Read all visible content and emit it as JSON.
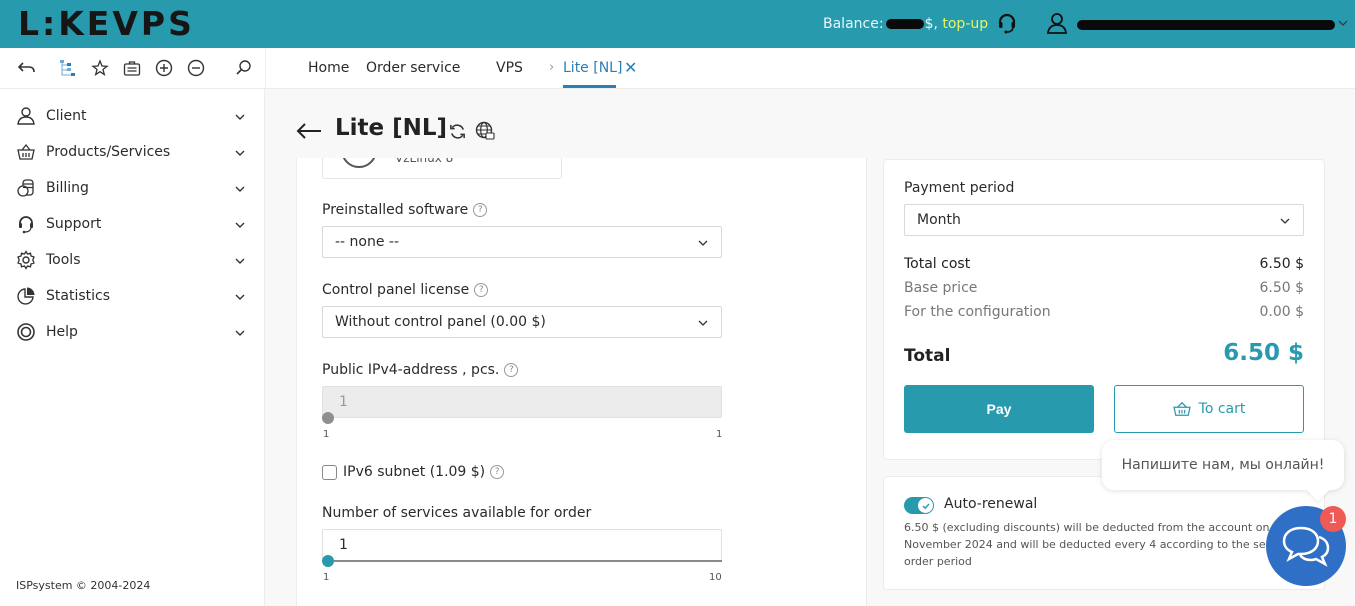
{
  "header": {
    "logo": "L:KEVPS",
    "balance_label": "Balance:",
    "balance_currency": "$,",
    "topup_label": "top-up",
    "accent_color": "#279aad"
  },
  "toolbar": {
    "icons": [
      "back-icon",
      "tree-icon",
      "star-icon",
      "briefcase-icon",
      "plus-circle-icon",
      "minus-circle-icon",
      "search-icon"
    ],
    "breadcrumbs": [
      {
        "label": "Home"
      },
      {
        "label": "Order service"
      },
      {
        "label": "VPS"
      },
      {
        "label": "Lite [NL]",
        "active": true
      }
    ],
    "breadcrumb_separator": "›",
    "close_label": "✕"
  },
  "sidebar": {
    "items": [
      {
        "label": "Client",
        "icon": "user-icon"
      },
      {
        "label": "Products/Services",
        "icon": "basket-icon"
      },
      {
        "label": "Billing",
        "icon": "coins-icon"
      },
      {
        "label": "Support",
        "icon": "headset-icon"
      },
      {
        "label": "Tools",
        "icon": "gear-icon"
      },
      {
        "label": "Statistics",
        "icon": "pie-chart-icon"
      },
      {
        "label": "Help",
        "icon": "lifebuoy-icon"
      }
    ],
    "copyright": "ISPsystem © 2004-2024"
  },
  "page": {
    "title": "Lite [NL]",
    "os_card_text": "VzLinux 8"
  },
  "form": {
    "preinstalled": {
      "label": "Preinstalled software",
      "value": "-- none --"
    },
    "control_panel": {
      "label": "Control panel license",
      "value": "Without control panel (0.00 $)"
    },
    "ipv4": {
      "label": "Public IPv4-address , pcs.",
      "value": "1",
      "min": "1",
      "max": "1"
    },
    "ipv6": {
      "label": "IPv6 subnet (1.09 $)",
      "checked": false
    },
    "services": {
      "label": "Number of services available for order",
      "value": "1",
      "min": "1",
      "max": "10"
    },
    "help_glyph": "?"
  },
  "pricing": {
    "period_label": "Payment period",
    "period_value": "Month",
    "total_cost_label": "Total cost",
    "total_cost_value": "6.50 $",
    "base_price_label": "Base price",
    "base_price_value": "6.50 $",
    "config_label": "For the configuration",
    "config_value": "0.00 $",
    "total_label": "Total",
    "total_value": "6.50 $",
    "pay_label": "Pay",
    "cart_label": "To cart"
  },
  "renewal": {
    "enabled": true,
    "label": "Auto-renewal",
    "text": "6.50 $ (excluding discounts) will be deducted from the account on 4 November 2024 and will be deducted every 4 according to the selected order period"
  },
  "chat": {
    "bubble_text": "Напишите нам, мы онлайн!",
    "badge_count": "1",
    "button_color": "#2f6fc6",
    "badge_color": "#f05a55"
  }
}
